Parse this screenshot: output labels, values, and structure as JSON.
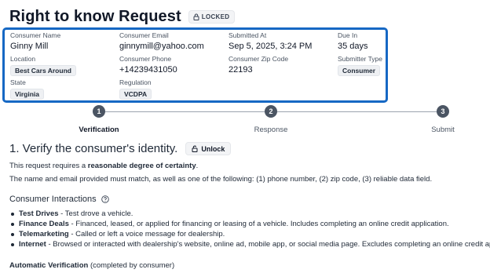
{
  "header": {
    "title": "Right to know Request",
    "lock_badge": "LOCKED"
  },
  "details": {
    "consumer_name": {
      "label": "Consumer Name",
      "value": "Ginny Mill"
    },
    "consumer_email": {
      "label": "Consumer Email",
      "value": "ginnymill@yahoo.com"
    },
    "submitted_at": {
      "label": "Submitted At",
      "value": "Sep 5, 2025, 3:24 PM"
    },
    "due_in": {
      "label": "Due In",
      "value": "35 days"
    },
    "location": {
      "label": "Location",
      "value": "Best Cars Around"
    },
    "consumer_phone": {
      "label": "Consumer Phone",
      "value": "+14239431050"
    },
    "consumer_zip": {
      "label": "Consumer Zip Code",
      "value": "22193"
    },
    "submitter_type": {
      "label": "Submitter Type",
      "value": "Consumer"
    },
    "state": {
      "label": "State",
      "value": "Virginia"
    },
    "regulation": {
      "label": "Regulation",
      "value": "VCDPA"
    }
  },
  "stepper": {
    "steps": [
      {
        "number": "1",
        "label": "Verification",
        "active": true
      },
      {
        "number": "2",
        "label": "Response",
        "active": false
      },
      {
        "number": "3",
        "label": "Submit",
        "active": false
      }
    ]
  },
  "verify": {
    "title": "1. Verify the consumer's identity.",
    "unlock_label": "Unlock",
    "certainty_prefix": "This request requires a ",
    "certainty_bold": "reasonable degree of certainty",
    "certainty_suffix": ".",
    "match_text": "The name and email provided must match, as well as one of the following: (1) phone number, (2) zip code, (3) reliable data field."
  },
  "interactions": {
    "title": "Consumer Interactions",
    "items": [
      {
        "term": "Test Drives",
        "desc": " - Test drove a vehicle."
      },
      {
        "term": "Finance Deals",
        "desc": " - Financed, leased, or applied for financing or leasing of a vehicle. Includes completing an online credit application."
      },
      {
        "term": "Telemarketing",
        "desc": " - Called or left a voice message for dealership."
      },
      {
        "term": "Internet",
        "desc": " - Browsed or interacted with dealership's website, online ad, mobile app, or social media page. Excludes completing an online credit appli"
      }
    ]
  },
  "automatic": {
    "bold": "Automatic Verification",
    "rest": " (completed by consumer)"
  }
}
